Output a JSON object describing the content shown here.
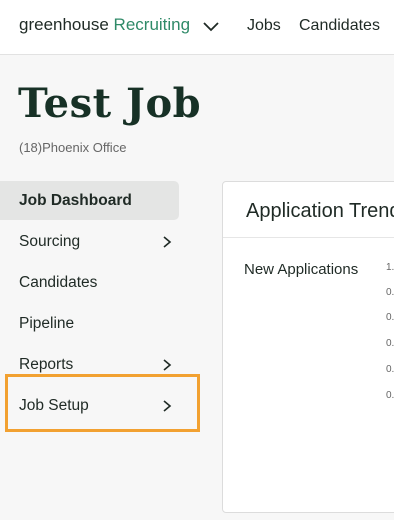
{
  "topbar": {
    "brand_prefix": "greenhouse",
    "brand_product": "Recruiting",
    "nav": [
      "Jobs",
      "Candidates"
    ]
  },
  "job": {
    "title": "Test Job",
    "subtitle": "(18)Phoenix Office"
  },
  "sidebar": {
    "items": [
      {
        "label": "Job Dashboard",
        "active": true,
        "has_chevron": false
      },
      {
        "label": "Sourcing",
        "active": false,
        "has_chevron": true
      },
      {
        "label": "Candidates",
        "active": false,
        "has_chevron": false
      },
      {
        "label": "Pipeline",
        "active": false,
        "has_chevron": false
      },
      {
        "label": "Reports",
        "active": false,
        "has_chevron": true
      },
      {
        "label": "Job Setup",
        "active": false,
        "has_chevron": true,
        "highlighted": true
      }
    ]
  },
  "card": {
    "title": "Application Trends",
    "series_label": "New Applications",
    "y_ticks": [
      "1.",
      "0.",
      "0.",
      "0.",
      "0.",
      "0."
    ]
  },
  "colors": {
    "brand_accent": "#2f8a68",
    "highlight": "#f2a131",
    "active_bg": "#e4e5e4"
  }
}
